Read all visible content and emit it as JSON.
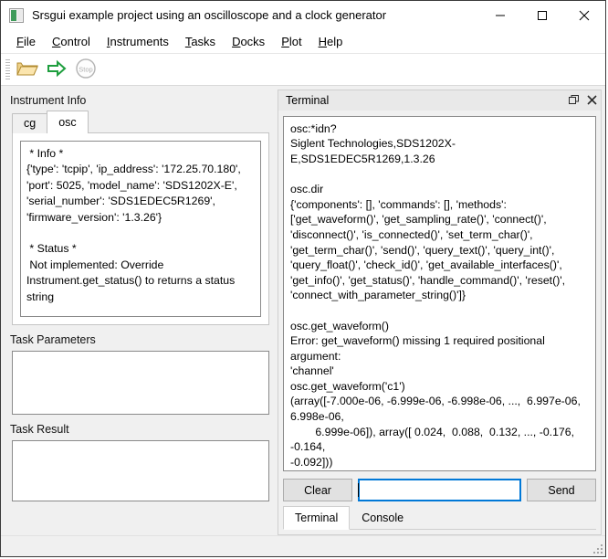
{
  "window": {
    "title": "Srsgui example project using an oscilloscope and a clock generator",
    "app_icon": "app-icon",
    "minimize_label": "—",
    "maximize_label": "□",
    "close_label": "✕"
  },
  "menu": [
    {
      "mnemonic": "F",
      "rest": "ile"
    },
    {
      "mnemonic": "C",
      "rest": "ontrol"
    },
    {
      "mnemonic": "I",
      "rest": "nstruments"
    },
    {
      "mnemonic": "T",
      "rest": "asks"
    },
    {
      "mnemonic": "D",
      "rest": "ocks"
    },
    {
      "mnemonic": "P",
      "rest": "lot"
    },
    {
      "mnemonic": "H",
      "rest": "elp"
    }
  ],
  "toolbar": {
    "open_icon": "folder-open-icon",
    "run_icon": "green-arrow-run-icon",
    "stop_icon": "stop-icon",
    "stop_label": "Stop"
  },
  "left": {
    "instrument_info_label": "Instrument Info",
    "tabs": [
      {
        "label": "cg",
        "active": false
      },
      {
        "label": "osc",
        "active": true
      }
    ],
    "info_text": " * Info *\n{'type': 'tcpip', 'ip_address': '172.25.70.180',\n'port': 5025, 'model_name': 'SDS1202X-E',\n'serial_number': 'SDS1EDEC5R1269',\n'firmware_version': '1.3.26'}\n\n * Status *\n Not implemented: Override\nInstrument.get_status() to returns a status\nstring",
    "task_parameters_label": "Task Parameters",
    "task_parameters_value": "",
    "task_result_label": "Task Result",
    "task_result_value": ""
  },
  "terminal": {
    "dock_title": "Terminal",
    "float_icon": "float-undock-icon",
    "close_icon": "close-icon",
    "output": "osc:*idn?\nSiglent Technologies,SDS1202X-E,SDS1EDEC5R1269,1.3.26\n\nosc.dir\n{'components': [], 'commands': [], 'methods':\n['get_waveform()', 'get_sampling_rate()', 'connect()',\n'disconnect()', 'is_connected()', 'set_term_char()',\n'get_term_char()', 'send()', 'query_text()', 'query_int()',\n'query_float()', 'check_id()', 'get_available_interfaces()',\n'get_info()', 'get_status()', 'handle_command()', 'reset()',\n'connect_with_parameter_string()']}\n\nosc.get_waveform()\nError: get_waveform() missing 1 required positional argument:\n'channel'\nosc.get_waveform('c1')\n(array([-7.000e-06, -6.999e-06, -6.998e-06, ...,  6.997e-06,\n6.998e-06,\n        6.999e-06]), array([ 0.024,  0.088,  0.132, ..., -0.176, -0.164,\n-0.092]))",
    "clear_label": "Clear",
    "send_label": "Send",
    "input_value": "",
    "input_placeholder": "",
    "bottom_tabs": [
      {
        "label": "Terminal",
        "active": true
      },
      {
        "label": "Console",
        "active": false
      }
    ]
  },
  "statusbar": {
    "text": "",
    "grip_icon": "resize-grip-icon"
  },
  "colors": {
    "window_bg": "#f0f0f0",
    "focus_blue": "#0078d7",
    "accent_green": "#1e9e3e",
    "folder_yellow": "#e8c35a"
  }
}
